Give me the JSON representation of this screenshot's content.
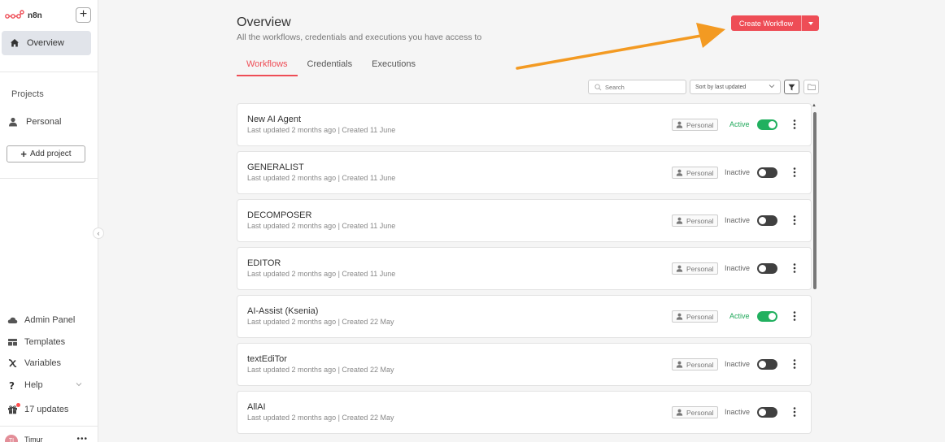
{
  "app": {
    "name": "n8n",
    "colors": {
      "brand": "#ee4d56",
      "active": "#21a95b",
      "toggle_off": "#404040"
    }
  },
  "sidebar": {
    "new_button": "+",
    "overview": {
      "label": "Overview",
      "icon": "home-icon"
    },
    "projects_label": "Projects",
    "personal": {
      "label": "Personal",
      "icon": "user-icon"
    },
    "add_project": {
      "plus": "+",
      "label": "Add project"
    },
    "collapse": "‹",
    "bottom": {
      "admin_panel": {
        "label": "Admin Panel",
        "icon": "cloud-icon"
      },
      "templates": {
        "label": "Templates",
        "icon": "templates-icon"
      },
      "variables": {
        "label": "Variables",
        "icon": "variables-icon"
      },
      "help": {
        "label": "Help",
        "icon": "help-icon"
      },
      "updates": {
        "label": "17 updates",
        "icon": "gift-icon"
      }
    },
    "user": {
      "initials": "TI",
      "name": "Timur",
      "menu": "•••"
    }
  },
  "header": {
    "title": "Overview",
    "subtitle": "All the workflows, credentials and executions you have access to",
    "create_button": "Create Workflow"
  },
  "tabs": [
    {
      "label": "Workflows",
      "active": true
    },
    {
      "label": "Credentials",
      "active": false
    },
    {
      "label": "Executions",
      "active": false
    }
  ],
  "toolbar": {
    "search_placeholder": "Search",
    "sort_value": "Sort by last updated"
  },
  "workflows": [
    {
      "name": "New AI Agent",
      "meta": "Last updated 2 months ago | Created 11 June",
      "owner": "Personal",
      "status": "Active",
      "active": true
    },
    {
      "name": "GENERALIST",
      "meta": "Last updated 2 months ago | Created 11 June",
      "owner": "Personal",
      "status": "Inactive",
      "active": false
    },
    {
      "name": "DECOMPOSER",
      "meta": "Last updated 2 months ago | Created 11 June",
      "owner": "Personal",
      "status": "Inactive",
      "active": false
    },
    {
      "name": "EDITOR",
      "meta": "Last updated 2 months ago | Created 11 June",
      "owner": "Personal",
      "status": "Inactive",
      "active": false
    },
    {
      "name": "AI-Assist (Ksenia)",
      "meta": "Last updated 2 months ago | Created 22 May",
      "owner": "Personal",
      "status": "Active",
      "active": true
    },
    {
      "name": "textEdiTor",
      "meta": "Last updated 2 months ago | Created 22 May",
      "owner": "Personal",
      "status": "Inactive",
      "active": false
    },
    {
      "name": "AllAI",
      "meta": "Last updated 2 months ago | Created 22 May",
      "owner": "Personal",
      "status": "Inactive",
      "active": false
    }
  ]
}
